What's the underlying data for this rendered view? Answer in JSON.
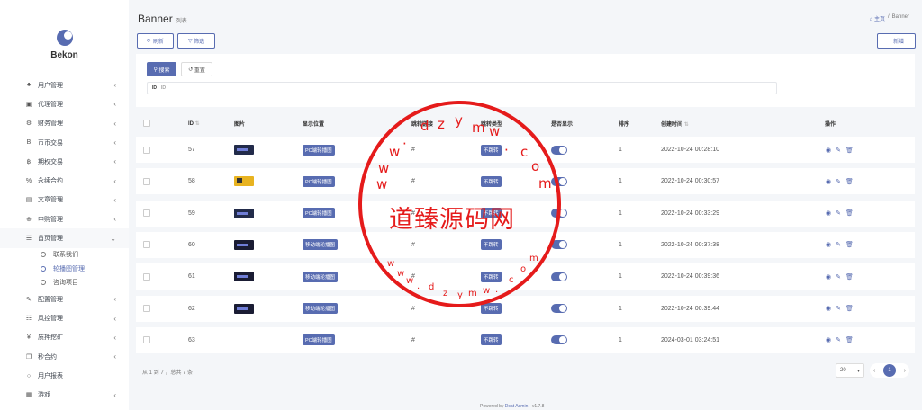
{
  "brand": {
    "name": "Bekon"
  },
  "sidebar": {
    "items": [
      {
        "icon": "user-icon",
        "glyph": "♣",
        "label": "用户管理",
        "arrow": "‹"
      },
      {
        "icon": "id-card-icon",
        "glyph": "▣",
        "label": "代理管理",
        "arrow": "‹"
      },
      {
        "icon": "settings-icon",
        "glyph": "⚙",
        "label": "财务管理",
        "arrow": "‹"
      },
      {
        "icon": "bitcoin-icon",
        "glyph": "B",
        "label": "币币交易",
        "arrow": "‹"
      },
      {
        "icon": "bitcoin-b-icon",
        "glyph": "฿",
        "label": "期权交易",
        "arrow": "‹"
      },
      {
        "icon": "link-icon",
        "glyph": "%",
        "label": "永续合约",
        "arrow": "‹"
      },
      {
        "icon": "keyboard-icon",
        "glyph": "▤",
        "label": "文章管理",
        "arrow": "‹"
      },
      {
        "icon": "globe-icon",
        "glyph": "⊕",
        "label": "申购管理",
        "arrow": "‹"
      },
      {
        "icon": "list-icon",
        "glyph": "☰",
        "label": "首页管理",
        "arrow": "⌄"
      }
    ],
    "sub_items": [
      {
        "label": "联系我们"
      },
      {
        "label": "轮播图管理"
      },
      {
        "label": "咨询项目"
      }
    ],
    "items_after": [
      {
        "icon": "wrench-icon",
        "glyph": "✎",
        "label": "配置管理",
        "arrow": "‹"
      },
      {
        "icon": "list-alt-icon",
        "glyph": "☷",
        "label": "风控管理",
        "arrow": "‹"
      },
      {
        "icon": "yen-icon",
        "glyph": "¥",
        "label": "质押挖矿",
        "arrow": "‹"
      },
      {
        "icon": "copy-icon",
        "glyph": "❐",
        "label": "秒合约",
        "arrow": "‹"
      },
      {
        "icon": "circle-icon",
        "glyph": "○",
        "label": "用户报表",
        "arrow": ""
      },
      {
        "icon": "game-icon",
        "glyph": "▦",
        "label": "游戏",
        "arrow": "‹"
      }
    ]
  },
  "header": {
    "title": "Banner",
    "subtitle": "列表"
  },
  "breadcrumb": {
    "home": "主页",
    "sep": "/",
    "current": "Banner"
  },
  "toolbar": {
    "refresh": "刷新",
    "filter": "筛选",
    "new": "新增"
  },
  "filter": {
    "search": "搜索",
    "reset": "重置",
    "id_label": "ID",
    "id_placeholder": "ID"
  },
  "table": {
    "headers": {
      "id": "ID",
      "image": "图片",
      "position": "显示位置",
      "jump": "跳转链接",
      "jump_type": "跳转类型",
      "show": "是否显示",
      "sort": "排序",
      "created": "创建时间",
      "ops": "操作"
    },
    "rows": [
      {
        "id": "57",
        "thumb": "",
        "position": "PC端轮播图",
        "link": "#",
        "jump_type": "不跳转",
        "sort": "1",
        "created": "2022-10-24 00:28:10"
      },
      {
        "id": "58",
        "thumb": "yellow",
        "position": "PC端轮播图",
        "link": "#",
        "jump_type": "不跳转",
        "sort": "1",
        "created": "2022-10-24 00:30:57"
      },
      {
        "id": "59",
        "thumb": "",
        "position": "PC端轮播图",
        "link": "#",
        "jump_type": "不跳转",
        "sort": "1",
        "created": "2022-10-24 00:33:29"
      },
      {
        "id": "60",
        "thumb": "wide",
        "position": "移动端轮播图",
        "link": "#",
        "jump_type": "不跳转",
        "sort": "1",
        "created": "2022-10-24 00:37:38"
      },
      {
        "id": "61",
        "thumb": "wide",
        "position": "移动端轮播图",
        "link": "#",
        "jump_type": "不跳转",
        "sort": "1",
        "created": "2022-10-24 00:39:36"
      },
      {
        "id": "62",
        "thumb": "wide",
        "position": "移动端轮播图",
        "link": "#",
        "jump_type": "不跳转",
        "sort": "1",
        "created": "2022-10-24 00:39:44"
      },
      {
        "id": "63",
        "thumb": "none",
        "position": "PC端轮播图",
        "link": "#",
        "jump_type": "不跳转",
        "sort": "1",
        "created": "2024-03-01 03:24:51"
      }
    ]
  },
  "summary": "从 1 到 7 ，总共 7 条",
  "page_size": "20",
  "pager": {
    "current": "1"
  },
  "powered": {
    "prefix": "Powered by",
    "link": "Dcat Admin",
    "sep": "·",
    "version": "v1.7.8"
  },
  "watermark": {
    "text": "道臻源码网",
    "chars": [
      "w",
      "w",
      "w",
      "·",
      "d",
      "z",
      "y",
      "m",
      "w",
      "·",
      "c",
      "o",
      "m"
    ]
  },
  "colors": {
    "accent": "#586cb1",
    "stamp": "#e51b1b"
  }
}
